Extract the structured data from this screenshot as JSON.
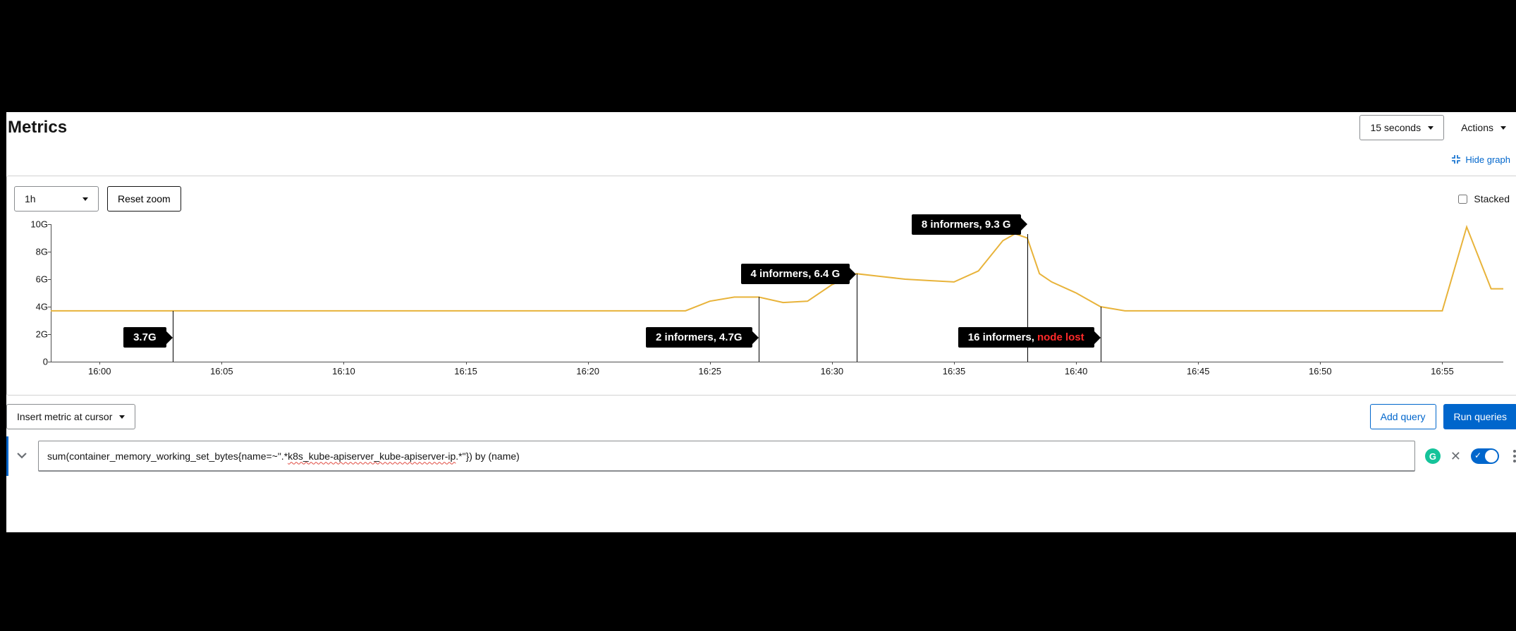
{
  "header": {
    "title": "Metrics",
    "refresh_label": "15 seconds",
    "actions_label": "Actions"
  },
  "graph_link": {
    "hide_label": "Hide graph"
  },
  "chart_toolbar": {
    "range_label": "1h",
    "reset_zoom_label": "Reset zoom",
    "stacked_label": "Stacked",
    "stacked_checked": false
  },
  "query_bar": {
    "insert_metric_label": "Insert metric at cursor",
    "add_query_label": "Add query",
    "run_queries_label": "Run queries"
  },
  "query": {
    "expression_plain": "sum(container_memory_working_set_bytes{name=~\".*k8s_kube-apiserver_kube-apiserver-ip.*\"}) by (name)",
    "enabled": true
  },
  "annotations": [
    {
      "label": "3.7G",
      "x_time": "16:03",
      "style": "left"
    },
    {
      "label": "2 informers, 4.7G",
      "x_time": "16:27",
      "style": "left"
    },
    {
      "label": "4 informers, 6.4 G",
      "x_time": "16:31",
      "style": "left"
    },
    {
      "label": "8 informers, 9.3 G",
      "x_time": "16:38",
      "style": "left-top"
    },
    {
      "label_prefix": "16 informers, ",
      "label_red": "node lost",
      "x_time": "16:41",
      "style": "left"
    }
  ],
  "chart_data": {
    "type": "line",
    "title": "",
    "xlabel": "",
    "ylabel": "",
    "x_unit": "time (HH:MM)",
    "y_unit": "bytes (G)",
    "ylim": [
      0,
      10
    ],
    "y_ticks": [
      "0",
      "2G",
      "4G",
      "6G",
      "8G",
      "10G"
    ],
    "x_ticks": [
      "16:00",
      "16:05",
      "16:10",
      "16:15",
      "16:20",
      "16:25",
      "16:30",
      "16:35",
      "16:40",
      "16:45",
      "16:50",
      "16:55"
    ],
    "series": [
      {
        "name": "sum(container_memory_working_set_bytes) by (name)",
        "color": "#e8b33a",
        "points": [
          {
            "x": "15:58",
            "y": 3.7
          },
          {
            "x": "16:00",
            "y": 3.7
          },
          {
            "x": "16:05",
            "y": 3.7
          },
          {
            "x": "16:10",
            "y": 3.7
          },
          {
            "x": "16:15",
            "y": 3.7
          },
          {
            "x": "16:20",
            "y": 3.7
          },
          {
            "x": "16:24",
            "y": 3.7
          },
          {
            "x": "16:25",
            "y": 4.4
          },
          {
            "x": "16:26",
            "y": 4.7
          },
          {
            "x": "16:27",
            "y": 4.7
          },
          {
            "x": "16:28",
            "y": 4.3
          },
          {
            "x": "16:29",
            "y": 4.4
          },
          {
            "x": "16:30",
            "y": 5.6
          },
          {
            "x": "16:31",
            "y": 6.4
          },
          {
            "x": "16:32",
            "y": 6.2
          },
          {
            "x": "16:33",
            "y": 6.0
          },
          {
            "x": "16:34",
            "y": 5.9
          },
          {
            "x": "16:35",
            "y": 5.8
          },
          {
            "x": "16:36",
            "y": 6.6
          },
          {
            "x": "16:37",
            "y": 8.8
          },
          {
            "x": "16:37.5",
            "y": 9.3
          },
          {
            "x": "16:38",
            "y": 9.0
          },
          {
            "x": "16:38.5",
            "y": 6.4
          },
          {
            "x": "16:39",
            "y": 5.8
          },
          {
            "x": "16:40",
            "y": 5.0
          },
          {
            "x": "16:41",
            "y": 4.0
          },
          {
            "x": "16:42",
            "y": 3.7
          },
          {
            "x": "16:45",
            "y": 3.7
          },
          {
            "x": "16:50",
            "y": 3.7
          },
          {
            "x": "16:55",
            "y": 3.7
          },
          {
            "x": "16:56",
            "y": 9.8
          },
          {
            "x": "16:57",
            "y": 5.3
          },
          {
            "x": "16:57.5",
            "y": 5.3
          }
        ]
      }
    ]
  }
}
